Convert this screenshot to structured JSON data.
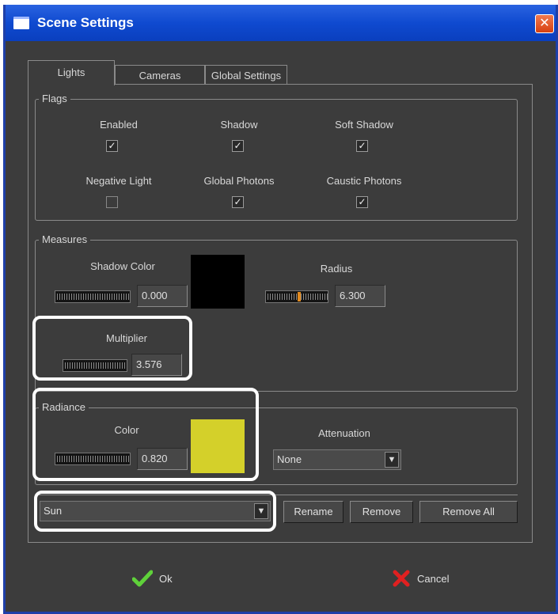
{
  "window": {
    "title": "Scene Settings",
    "close_label": "✕"
  },
  "tabs": [
    {
      "label": "Lights",
      "active": true
    },
    {
      "label": "Cameras",
      "active": false
    },
    {
      "label": "Global Settings",
      "active": false
    }
  ],
  "flags": {
    "legend": "Flags",
    "items": [
      {
        "label": "Enabled",
        "checked": true
      },
      {
        "label": "Shadow",
        "checked": true
      },
      {
        "label": "Soft Shadow",
        "checked": true
      },
      {
        "label": "Negative Light",
        "checked": false
      },
      {
        "label": "Global Photons",
        "checked": true
      },
      {
        "label": "Caustic Photons",
        "checked": true
      }
    ]
  },
  "measures": {
    "legend": "Measures",
    "shadow_color": {
      "label": "Shadow Color",
      "value": "0.000",
      "swatch": "#000000"
    },
    "radius": {
      "label": "Radius",
      "value": "6.300"
    },
    "multiplier": {
      "label": "Multiplier",
      "value": "3.576"
    }
  },
  "radiance": {
    "legend": "Radiance",
    "color": {
      "label": "Color",
      "value": "0.820",
      "swatch": "#d4d02a"
    },
    "attenuation": {
      "label": "Attenuation",
      "selected": "None"
    }
  },
  "light_select": {
    "selected": "Sun"
  },
  "actions": {
    "rename": "Rename",
    "remove": "Remove",
    "remove_all": "Remove All"
  },
  "footer": {
    "ok": "Ok",
    "cancel": "Cancel"
  },
  "colors": {
    "accent_ok": "#5fd13a",
    "accent_cancel": "#e02020",
    "titlebar": "#0f4ad0"
  }
}
